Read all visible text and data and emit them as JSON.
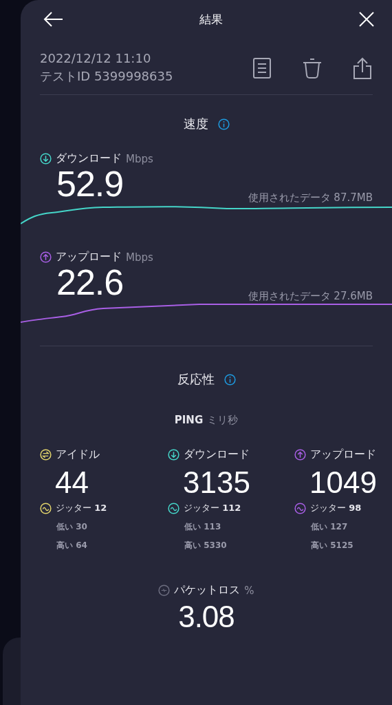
{
  "header": {
    "title": "結果"
  },
  "test": {
    "datetime": "2022/12/12 11:10",
    "test_id": "テストID 5399998635"
  },
  "speed": {
    "title": "速度",
    "items": [
      {
        "kind": "download",
        "label": "ダウンロード",
        "unit": "Mbps",
        "value": "52.9",
        "data_used": "使用されたデータ 87.7MB",
        "color": "#45d6c9"
      },
      {
        "kind": "upload",
        "label": "アップロード",
        "unit": "Mbps",
        "value": "22.6",
        "data_used": "使用されたデータ 27.6MB",
        "color": "#a95fe6"
      }
    ]
  },
  "responsiveness": {
    "title": "反応性",
    "ping_label": "PING",
    "ping_unit": "ミリ秒",
    "columns": [
      {
        "kind": "idle",
        "label": "アイドル",
        "value": "44",
        "jitter_label": "ジッター",
        "jitter": "12",
        "low": "低い 30",
        "high": "高い 64",
        "color": "#e3d56c"
      },
      {
        "kind": "download",
        "label": "ダウンロード",
        "value": "3135",
        "jitter_label": "ジッター",
        "jitter": "112",
        "low": "低い 113",
        "high": "高い 5330",
        "color": "#45d6c9"
      },
      {
        "kind": "upload",
        "label": "アップロード",
        "value": "1049",
        "jitter_label": "ジッター",
        "jitter": "98",
        "low": "低い 127",
        "high": "高い 5125",
        "color": "#a95fe6"
      }
    ]
  },
  "packet_loss": {
    "label": "パケットロス",
    "unit": "%",
    "value": "3.08"
  }
}
